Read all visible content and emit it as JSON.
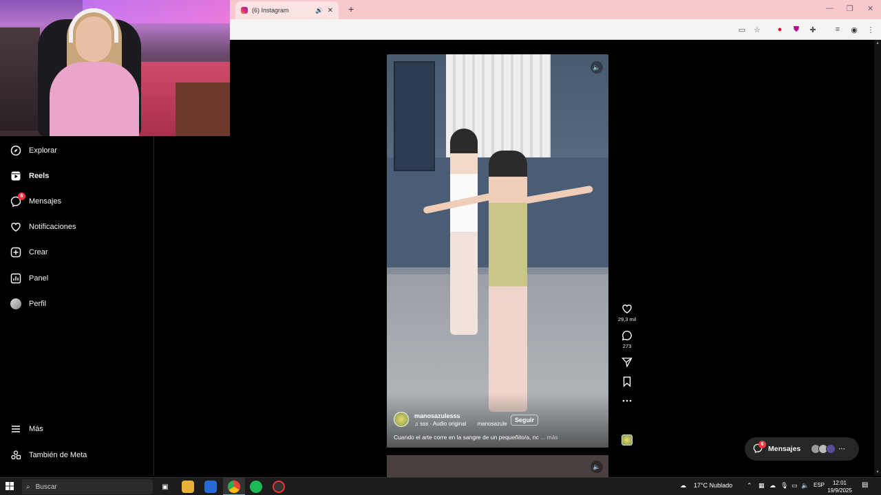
{
  "browser": {
    "tab_title": "(6) Instagram",
    "new_tab": "+",
    "tab_close": "✕",
    "tab_sound": "🔊",
    "window_controls": [
      "—",
      "❐",
      "✕"
    ]
  },
  "nav": {
    "items": [
      {
        "label": "Explorar",
        "icon": "compass-icon"
      },
      {
        "label": "Reels",
        "icon": "reels-icon",
        "active": true
      },
      {
        "label": "Mensajes",
        "icon": "messenger-icon",
        "badge": "6"
      },
      {
        "label": "Notificaciones",
        "icon": "heart-icon"
      },
      {
        "label": "Crear",
        "icon": "plus-square-icon"
      },
      {
        "label": "Panel",
        "icon": "bar-chart-icon"
      },
      {
        "label": "Perfil",
        "icon": "avatar"
      }
    ],
    "more_label": "Más",
    "meta_label": "También de Meta"
  },
  "reel": {
    "username": "manosazulesss",
    "audio": "♫ sss · Audio original",
    "audio_user": "manosazule",
    "follow_label": "Seguir",
    "caption": "Cuando el arte corre en la sangre de un pequeñito/a, nc",
    "more_label": "... más",
    "volume_icon": "🔈"
  },
  "actions": {
    "likes": "29,3 mil",
    "comments": "273"
  },
  "messages_pill": {
    "label": "Mensajes",
    "badge": "6"
  },
  "taskbar": {
    "search_placeholder": "Buscar",
    "weather": "17°C  Nublado",
    "language": "ESP",
    "time": "12:01",
    "date": "19/9/2025"
  }
}
